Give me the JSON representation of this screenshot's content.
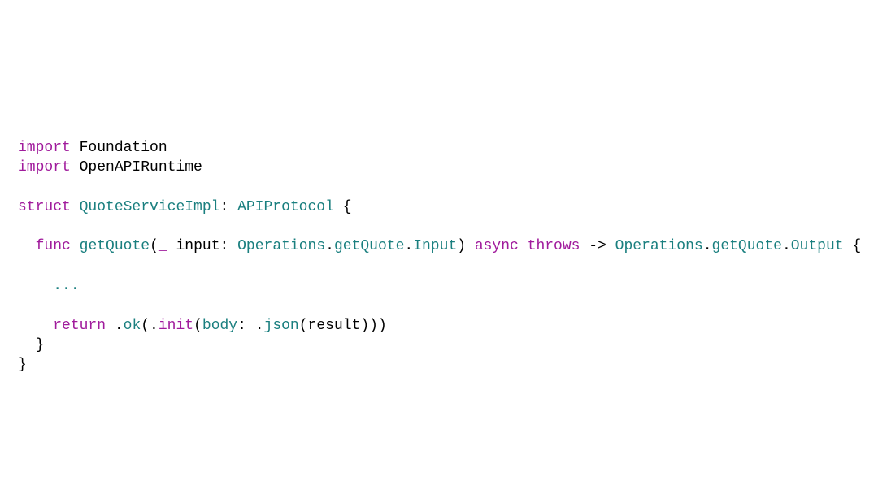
{
  "code": {
    "lines": [
      {
        "tokens": [
          {
            "cls": "kw",
            "t": "import"
          },
          {
            "cls": "plain",
            "t": " Foundation"
          }
        ]
      },
      {
        "tokens": [
          {
            "cls": "kw",
            "t": "import"
          },
          {
            "cls": "plain",
            "t": " OpenAPIRuntime"
          }
        ]
      },
      {
        "tokens": []
      },
      {
        "tokens": [
          {
            "cls": "kw",
            "t": "struct"
          },
          {
            "cls": "plain",
            "t": " "
          },
          {
            "cls": "type",
            "t": "QuoteServiceImpl"
          },
          {
            "cls": "plain",
            "t": ": "
          },
          {
            "cls": "type",
            "t": "APIProtocol"
          },
          {
            "cls": "plain",
            "t": " {"
          }
        ]
      },
      {
        "tokens": []
      },
      {
        "tokens": [
          {
            "cls": "plain",
            "t": "  "
          },
          {
            "cls": "kw",
            "t": "func"
          },
          {
            "cls": "plain",
            "t": " "
          },
          {
            "cls": "type",
            "t": "getQuote"
          },
          {
            "cls": "plain",
            "t": "("
          },
          {
            "cls": "kw",
            "t": "_"
          },
          {
            "cls": "plain",
            "t": " input: "
          },
          {
            "cls": "type",
            "t": "Operations"
          },
          {
            "cls": "plain",
            "t": "."
          },
          {
            "cls": "type",
            "t": "getQuote"
          },
          {
            "cls": "plain",
            "t": "."
          },
          {
            "cls": "type",
            "t": "Input"
          },
          {
            "cls": "plain",
            "t": ") "
          },
          {
            "cls": "kw",
            "t": "async"
          },
          {
            "cls": "plain",
            "t": " "
          },
          {
            "cls": "kw",
            "t": "throws"
          },
          {
            "cls": "plain",
            "t": " -> "
          },
          {
            "cls": "type",
            "t": "Operations"
          },
          {
            "cls": "plain",
            "t": "."
          },
          {
            "cls": "type",
            "t": "getQuote"
          },
          {
            "cls": "plain",
            "t": "."
          },
          {
            "cls": "type",
            "t": "Output"
          },
          {
            "cls": "plain",
            "t": " {"
          }
        ]
      },
      {
        "tokens": []
      },
      {
        "tokens": [
          {
            "cls": "plain",
            "t": "    "
          },
          {
            "cls": "type",
            "t": "..."
          }
        ]
      },
      {
        "tokens": []
      },
      {
        "tokens": [
          {
            "cls": "plain",
            "t": "    "
          },
          {
            "cls": "kw",
            "t": "return"
          },
          {
            "cls": "plain",
            "t": " ."
          },
          {
            "cls": "type",
            "t": "ok"
          },
          {
            "cls": "plain",
            "t": "(."
          },
          {
            "cls": "kw",
            "t": "init"
          },
          {
            "cls": "plain",
            "t": "("
          },
          {
            "cls": "type",
            "t": "body"
          },
          {
            "cls": "plain",
            "t": ": ."
          },
          {
            "cls": "type",
            "t": "json"
          },
          {
            "cls": "plain",
            "t": "(result)))"
          }
        ]
      },
      {
        "tokens": [
          {
            "cls": "plain",
            "t": "  }"
          }
        ]
      },
      {
        "tokens": [
          {
            "cls": "plain",
            "t": "}"
          }
        ]
      }
    ]
  }
}
